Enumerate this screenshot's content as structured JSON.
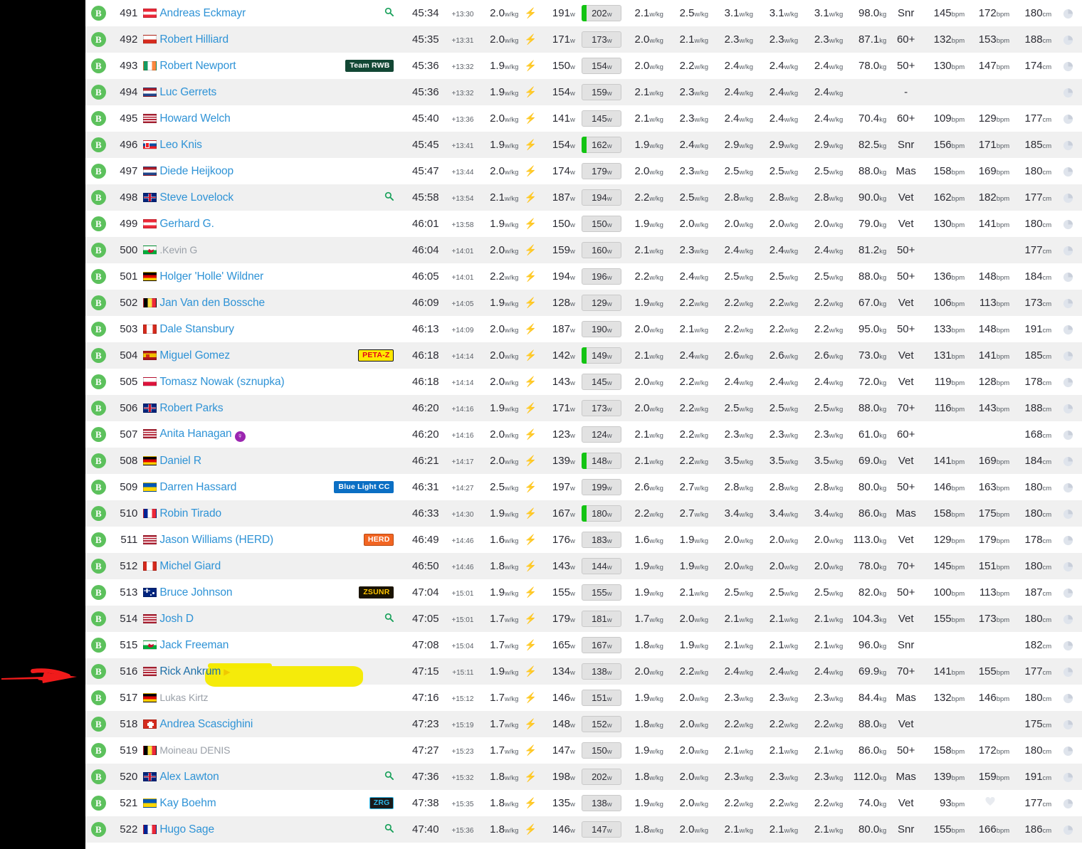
{
  "meta": {
    "highlighted_position": "516",
    "highlighted_rider": "Rick Ankrum",
    "annotation": {
      "type": "red-arrow",
      "points_to": "516"
    },
    "colors": {
      "rider_link": "#2f93d6",
      "badge_green": "#5cc15c",
      "bolt_green": "#28c840",
      "np_flag_green": "#13c413",
      "highlight_yellow": "#f5ea00",
      "arrow_red": "#f01b1b",
      "female_purple": "#9b26b0"
    }
  },
  "units": {
    "power": "w",
    "wkg": "w/kg",
    "weight": "kg",
    "hr": "bpm",
    "height": "cm"
  },
  "rows": [
    {
      "pos": "491",
      "flag": "at",
      "name": "Andreas Eckmayr",
      "muted": false,
      "search": true,
      "team": null,
      "time": "45:34",
      "gap": "+13:30",
      "wkg": "2.0",
      "bolt": true,
      "avg_power": "191",
      "np": "202",
      "np_flag": true,
      "p5": "2.1",
      "p4": "2.5",
      "p3": "3.1",
      "p2": "3.1",
      "p1": "3.1",
      "weight": "98.0",
      "cat": "Snr",
      "hr_avg": "145",
      "hr_max": "172",
      "height": "180",
      "hr_max_icon": false,
      "female": false,
      "play": false
    },
    {
      "pos": "492",
      "flag": "cl",
      "name": "Robert Hilliard",
      "muted": false,
      "search": false,
      "team": null,
      "time": "45:35",
      "gap": "+13:31",
      "wkg": "2.0",
      "bolt": true,
      "avg_power": "171",
      "np": "173",
      "np_flag": false,
      "p5": "2.0",
      "p4": "2.1",
      "p3": "2.3",
      "p2": "2.3",
      "p1": "2.3",
      "weight": "87.1",
      "cat": "60+",
      "hr_avg": "132",
      "hr_max": "153",
      "height": "188",
      "hr_max_icon": false,
      "female": false,
      "play": false
    },
    {
      "pos": "493",
      "flag": "ie",
      "name": "Robert Newport",
      "muted": false,
      "search": false,
      "team": {
        "label": "Team RWB",
        "bg": "#124734",
        "fg": "#ffffff",
        "border": "#124734"
      },
      "time": "45:36",
      "gap": "+13:32",
      "wkg": "1.9",
      "bolt": true,
      "avg_power": "150",
      "np": "154",
      "np_flag": false,
      "p5": "2.0",
      "p4": "2.2",
      "p3": "2.4",
      "p2": "2.4",
      "p1": "2.4",
      "weight": "78.0",
      "cat": "50+",
      "hr_avg": "130",
      "hr_max": "147",
      "height": "174",
      "hr_max_icon": false,
      "female": false,
      "play": false
    },
    {
      "pos": "494",
      "flag": "nl",
      "name": "Luc Gerrets",
      "muted": false,
      "search": false,
      "team": null,
      "time": "45:36",
      "gap": "+13:32",
      "wkg": "1.9",
      "bolt": true,
      "avg_power": "154",
      "np": "159",
      "np_flag": false,
      "p5": "2.1",
      "p4": "2.3",
      "p3": "2.4",
      "p2": "2.4",
      "p1": "2.4",
      "weight": "",
      "cat": "-",
      "hr_avg": "",
      "hr_max": "",
      "height": "",
      "hr_max_icon": false,
      "female": false,
      "play": false
    },
    {
      "pos": "495",
      "flag": "us",
      "name": "Howard Welch",
      "muted": false,
      "search": false,
      "team": null,
      "time": "45:40",
      "gap": "+13:36",
      "wkg": "2.0",
      "bolt": true,
      "avg_power": "141",
      "np": "145",
      "np_flag": false,
      "p5": "2.1",
      "p4": "2.3",
      "p3": "2.4",
      "p2": "2.4",
      "p1": "2.4",
      "weight": "70.4",
      "cat": "60+",
      "hr_avg": "109",
      "hr_max": "129",
      "height": "177",
      "hr_max_icon": false,
      "female": false,
      "play": false
    },
    {
      "pos": "496",
      "flag": "sk",
      "name": "Leo Knis",
      "muted": false,
      "search": false,
      "team": null,
      "time": "45:45",
      "gap": "+13:41",
      "wkg": "1.9",
      "bolt": true,
      "avg_power": "154",
      "np": "162",
      "np_flag": true,
      "p5": "1.9",
      "p4": "2.4",
      "p3": "2.9",
      "p2": "2.9",
      "p1": "2.9",
      "weight": "82.5",
      "cat": "Snr",
      "hr_avg": "156",
      "hr_max": "171",
      "height": "185",
      "hr_max_icon": false,
      "female": false,
      "play": false
    },
    {
      "pos": "497",
      "flag": "nl",
      "name": "Diede Heijkoop",
      "muted": false,
      "search": false,
      "team": null,
      "time": "45:47",
      "gap": "+13:44",
      "wkg": "2.0",
      "bolt": true,
      "avg_power": "174",
      "np": "179",
      "np_flag": false,
      "p5": "2.0",
      "p4": "2.3",
      "p3": "2.5",
      "p2": "2.5",
      "p1": "2.5",
      "weight": "88.0",
      "cat": "Mas",
      "hr_avg": "158",
      "hr_max": "169",
      "height": "180",
      "hr_max_icon": false,
      "female": false,
      "play": false
    },
    {
      "pos": "498",
      "flag": "gb",
      "name": "Steve Lovelock",
      "muted": false,
      "search": true,
      "team": null,
      "time": "45:58",
      "gap": "+13:54",
      "wkg": "2.1",
      "bolt": true,
      "avg_power": "187",
      "np": "194",
      "np_flag": false,
      "p5": "2.2",
      "p4": "2.5",
      "p3": "2.8",
      "p2": "2.8",
      "p1": "2.8",
      "weight": "90.0",
      "cat": "Vet",
      "hr_avg": "162",
      "hr_max": "182",
      "height": "177",
      "hr_max_icon": false,
      "female": false,
      "play": false
    },
    {
      "pos": "499",
      "flag": "at",
      "name": "Gerhard G.",
      "muted": false,
      "search": false,
      "team": null,
      "time": "46:01",
      "gap": "+13:58",
      "wkg": "1.9",
      "bolt": true,
      "avg_power": "150",
      "np": "150",
      "np_flag": false,
      "p5": "1.9",
      "p4": "2.0",
      "p3": "2.0",
      "p2": "2.0",
      "p1": "2.0",
      "weight": "79.0",
      "cat": "Vet",
      "hr_avg": "130",
      "hr_max": "141",
      "height": "180",
      "hr_max_icon": false,
      "female": false,
      "play": false
    },
    {
      "pos": "500",
      "flag": "wa",
      "name": ".Kevin G",
      "muted": true,
      "search": false,
      "team": null,
      "time": "46:04",
      "gap": "+14:01",
      "wkg": "2.0",
      "bolt": true,
      "avg_power": "159",
      "np": "160",
      "np_flag": false,
      "p5": "2.1",
      "p4": "2.3",
      "p3": "2.4",
      "p2": "2.4",
      "p1": "2.4",
      "weight": "81.2",
      "cat": "50+",
      "hr_avg": "",
      "hr_max": "",
      "height": "177",
      "hr_max_icon": false,
      "female": false,
      "play": false
    },
    {
      "pos": "501",
      "flag": "de",
      "name": "Holger 'Holle' Wildner",
      "muted": false,
      "search": false,
      "team": null,
      "time": "46:05",
      "gap": "+14:01",
      "wkg": "2.2",
      "bolt": true,
      "avg_power": "194",
      "np": "196",
      "np_flag": false,
      "p5": "2.2",
      "p4": "2.4",
      "p3": "2.5",
      "p2": "2.5",
      "p1": "2.5",
      "weight": "88.0",
      "cat": "50+",
      "hr_avg": "136",
      "hr_max": "148",
      "height": "184",
      "hr_max_icon": false,
      "female": false,
      "play": false
    },
    {
      "pos": "502",
      "flag": "be",
      "name": "Jan Van den Bossche",
      "muted": false,
      "search": false,
      "team": null,
      "time": "46:09",
      "gap": "+14:05",
      "wkg": "1.9",
      "bolt": true,
      "avg_power": "128",
      "np": "129",
      "np_flag": false,
      "p5": "1.9",
      "p4": "2.2",
      "p3": "2.2",
      "p2": "2.2",
      "p1": "2.2",
      "weight": "67.0",
      "cat": "Vet",
      "hr_avg": "106",
      "hr_max": "113",
      "height": "173",
      "hr_max_icon": false,
      "female": false,
      "play": false
    },
    {
      "pos": "503",
      "flag": "ca",
      "name": "Dale Stansbury",
      "muted": false,
      "search": false,
      "team": null,
      "time": "46:13",
      "gap": "+14:09",
      "wkg": "2.0",
      "bolt": true,
      "avg_power": "187",
      "np": "190",
      "np_flag": false,
      "p5": "2.0",
      "p4": "2.1",
      "p3": "2.2",
      "p2": "2.2",
      "p1": "2.2",
      "weight": "95.0",
      "cat": "50+",
      "hr_avg": "133",
      "hr_max": "148",
      "height": "191",
      "hr_max_icon": false,
      "female": false,
      "play": false
    },
    {
      "pos": "504",
      "flag": "es",
      "name": "Miguel Gomez",
      "muted": false,
      "search": false,
      "team": {
        "label": "PETA-Z",
        "bg": "#ffe800",
        "fg": "#e2001a",
        "border": "#111111"
      },
      "time": "46:18",
      "gap": "+14:14",
      "wkg": "2.0",
      "bolt": true,
      "avg_power": "142",
      "np": "149",
      "np_flag": true,
      "p5": "2.1",
      "p4": "2.4",
      "p3": "2.6",
      "p2": "2.6",
      "p1": "2.6",
      "weight": "73.0",
      "cat": "Vet",
      "hr_avg": "131",
      "hr_max": "141",
      "height": "185",
      "hr_max_icon": false,
      "female": false,
      "play": false
    },
    {
      "pos": "505",
      "flag": "pl",
      "name": "Tomasz Nowak (sznupka)",
      "muted": false,
      "search": false,
      "team": null,
      "time": "46:18",
      "gap": "+14:14",
      "wkg": "2.0",
      "bolt": true,
      "avg_power": "143",
      "np": "145",
      "np_flag": false,
      "p5": "2.0",
      "p4": "2.2",
      "p3": "2.4",
      "p2": "2.4",
      "p1": "2.4",
      "weight": "72.0",
      "cat": "Vet",
      "hr_avg": "119",
      "hr_max": "128",
      "height": "178",
      "hr_max_icon": false,
      "female": false,
      "play": false
    },
    {
      "pos": "506",
      "flag": "gb",
      "name": "Robert Parks",
      "muted": false,
      "search": false,
      "team": null,
      "time": "46:20",
      "gap": "+14:16",
      "wkg": "1.9",
      "bolt": true,
      "avg_power": "171",
      "np": "173",
      "np_flag": false,
      "p5": "2.0",
      "p4": "2.2",
      "p3": "2.5",
      "p2": "2.5",
      "p1": "2.5",
      "weight": "88.0",
      "cat": "70+",
      "hr_avg": "116",
      "hr_max": "143",
      "height": "188",
      "hr_max_icon": false,
      "female": false,
      "play": false
    },
    {
      "pos": "507",
      "flag": "us",
      "name": "Anita Hanagan",
      "muted": false,
      "search": false,
      "team": null,
      "time": "46:20",
      "gap": "+14:16",
      "wkg": "2.0",
      "bolt": true,
      "avg_power": "123",
      "np": "124",
      "np_flag": false,
      "p5": "2.1",
      "p4": "2.2",
      "p3": "2.3",
      "p2": "2.3",
      "p1": "2.3",
      "weight": "61.0",
      "cat": "60+",
      "hr_avg": "",
      "hr_max": "",
      "height": "168",
      "hr_max_icon": false,
      "female": true,
      "play": false
    },
    {
      "pos": "508",
      "flag": "de",
      "name": "Daniel R",
      "muted": false,
      "search": false,
      "team": null,
      "time": "46:21",
      "gap": "+14:17",
      "wkg": "2.0",
      "bolt": true,
      "avg_power": "139",
      "np": "148",
      "np_flag": true,
      "p5": "2.1",
      "p4": "2.2",
      "p3": "3.5",
      "p2": "3.5",
      "p1": "3.5",
      "weight": "69.0",
      "cat": "Vet",
      "hr_avg": "141",
      "hr_max": "169",
      "height": "184",
      "hr_max_icon": false,
      "female": false,
      "play": false
    },
    {
      "pos": "509",
      "flag": "ua",
      "name": "Darren Hassard",
      "muted": false,
      "search": false,
      "team": {
        "label": "Blue Light CC",
        "bg": "#0b6fc4",
        "fg": "#ffffff",
        "border": "#0b6fc4"
      },
      "time": "46:31",
      "gap": "+14:27",
      "wkg": "2.5",
      "bolt": true,
      "avg_power": "197",
      "np": "199",
      "np_flag": false,
      "p5": "2.6",
      "p4": "2.7",
      "p3": "2.8",
      "p2": "2.8",
      "p1": "2.8",
      "weight": "80.0",
      "cat": "50+",
      "hr_avg": "146",
      "hr_max": "163",
      "height": "180",
      "hr_max_icon": false,
      "female": false,
      "play": false
    },
    {
      "pos": "510",
      "flag": "fr",
      "name": "Robin Tirado",
      "muted": false,
      "search": false,
      "team": null,
      "time": "46:33",
      "gap": "+14:30",
      "wkg": "1.9",
      "bolt": true,
      "avg_power": "167",
      "np": "180",
      "np_flag": true,
      "p5": "2.2",
      "p4": "2.7",
      "p3": "3.4",
      "p2": "3.4",
      "p1": "3.4",
      "weight": "86.0",
      "cat": "Mas",
      "hr_avg": "158",
      "hr_max": "175",
      "height": "180",
      "hr_max_icon": false,
      "female": false,
      "play": false
    },
    {
      "pos": "511",
      "flag": "us",
      "name": "Jason Williams (HERD)",
      "muted": false,
      "search": false,
      "team": {
        "label": "HERD",
        "bg": "#f26522",
        "fg": "#ffffff",
        "border": "#b94a12"
      },
      "time": "46:49",
      "gap": "+14:46",
      "wkg": "1.6",
      "bolt": true,
      "avg_power": "176",
      "np": "183",
      "np_flag": false,
      "p5": "1.6",
      "p4": "1.9",
      "p3": "2.0",
      "p2": "2.0",
      "p1": "2.0",
      "weight": "113.0",
      "cat": "Vet",
      "hr_avg": "129",
      "hr_max": "179",
      "height": "178",
      "hr_max_icon": false,
      "female": false,
      "play": false
    },
    {
      "pos": "512",
      "flag": "ca",
      "name": "Michel Giard",
      "muted": false,
      "search": false,
      "team": null,
      "time": "46:50",
      "gap": "+14:46",
      "wkg": "1.8",
      "bolt": true,
      "avg_power": "143",
      "np": "144",
      "np_flag": false,
      "p5": "1.9",
      "p4": "1.9",
      "p3": "2.0",
      "p2": "2.0",
      "p1": "2.0",
      "weight": "78.0",
      "cat": "70+",
      "hr_avg": "145",
      "hr_max": "151",
      "height": "180",
      "hr_max_icon": false,
      "female": false,
      "play": false
    },
    {
      "pos": "513",
      "flag": "au",
      "name": "Bruce Johnson",
      "muted": false,
      "search": false,
      "team": {
        "label": "ZSUNR",
        "bg": "#1a1300",
        "fg": "#ffc400",
        "border": "#1a1300"
      },
      "time": "47:04",
      "gap": "+15:01",
      "wkg": "1.9",
      "bolt": true,
      "avg_power": "155",
      "np": "155",
      "np_flag": false,
      "p5": "1.9",
      "p4": "2.1",
      "p3": "2.5",
      "p2": "2.5",
      "p1": "2.5",
      "weight": "82.0",
      "cat": "50+",
      "hr_avg": "100",
      "hr_max": "113",
      "height": "187",
      "hr_max_icon": false,
      "female": false,
      "play": false
    },
    {
      "pos": "514",
      "flag": "us",
      "name": "Josh D",
      "muted": false,
      "search": true,
      "team": null,
      "time": "47:05",
      "gap": "+15:01",
      "wkg": "1.7",
      "bolt": true,
      "avg_power": "179",
      "np": "181",
      "np_flag": false,
      "p5": "1.7",
      "p4": "2.0",
      "p3": "2.1",
      "p2": "2.1",
      "p1": "2.1",
      "weight": "104.3",
      "cat": "Vet",
      "hr_avg": "155",
      "hr_max": "173",
      "height": "180",
      "hr_max_icon": false,
      "female": false,
      "play": false
    },
    {
      "pos": "515",
      "flag": "wa",
      "name": "Jack Freeman",
      "muted": false,
      "search": false,
      "team": null,
      "time": "47:08",
      "gap": "+15:04",
      "wkg": "1.7",
      "bolt": true,
      "avg_power": "165",
      "np": "167",
      "np_flag": false,
      "p5": "1.8",
      "p4": "1.9",
      "p3": "2.1",
      "p2": "2.1",
      "p1": "2.1",
      "weight": "96.0",
      "cat": "Snr",
      "hr_avg": "",
      "hr_max": "",
      "height": "182",
      "hr_max_icon": false,
      "female": false,
      "play": false
    },
    {
      "pos": "516",
      "flag": "us",
      "name": "Rick Ankrum",
      "muted": false,
      "search": false,
      "team": null,
      "time": "47:15",
      "gap": "+15:11",
      "wkg": "1.9",
      "bolt": true,
      "avg_power": "134",
      "np": "138",
      "np_flag": false,
      "p5": "2.0",
      "p4": "2.2",
      "p3": "2.4",
      "p2": "2.4",
      "p1": "2.4",
      "weight": "69.9",
      "cat": "70+",
      "hr_avg": "141",
      "hr_max": "155",
      "height": "177",
      "hr_max_icon": false,
      "female": false,
      "play": true
    },
    {
      "pos": "517",
      "flag": "de",
      "name": "Lukas Kirtz",
      "muted": true,
      "search": false,
      "team": null,
      "time": "47:16",
      "gap": "+15:12",
      "wkg": "1.7",
      "bolt": true,
      "avg_power": "146",
      "np": "151",
      "np_flag": false,
      "p5": "1.9",
      "p4": "2.0",
      "p3": "2.3",
      "p2": "2.3",
      "p1": "2.3",
      "weight": "84.4",
      "cat": "Mas",
      "hr_avg": "132",
      "hr_max": "146",
      "height": "180",
      "hr_max_icon": false,
      "female": false,
      "play": false
    },
    {
      "pos": "518",
      "flag": "ch",
      "name": "Andrea Scascighini",
      "muted": false,
      "search": false,
      "team": null,
      "time": "47:23",
      "gap": "+15:19",
      "wkg": "1.7",
      "bolt": true,
      "avg_power": "148",
      "np": "152",
      "np_flag": false,
      "p5": "1.8",
      "p4": "2.0",
      "p3": "2.2",
      "p2": "2.2",
      "p1": "2.2",
      "weight": "88.0",
      "cat": "Vet",
      "hr_avg": "",
      "hr_max": "",
      "height": "175",
      "hr_max_icon": false,
      "female": false,
      "play": false
    },
    {
      "pos": "519",
      "flag": "be",
      "name": "Moineau DENIS",
      "muted": true,
      "search": false,
      "team": null,
      "time": "47:27",
      "gap": "+15:23",
      "wkg": "1.7",
      "bolt": true,
      "avg_power": "147",
      "np": "150",
      "np_flag": false,
      "p5": "1.9",
      "p4": "2.0",
      "p3": "2.1",
      "p2": "2.1",
      "p1": "2.1",
      "weight": "86.0",
      "cat": "50+",
      "hr_avg": "158",
      "hr_max": "172",
      "height": "180",
      "hr_max_icon": false,
      "female": false,
      "play": false
    },
    {
      "pos": "520",
      "flag": "gb",
      "name": "Alex Lawton",
      "muted": false,
      "search": true,
      "team": null,
      "time": "47:36",
      "gap": "+15:32",
      "wkg": "1.8",
      "bolt": true,
      "avg_power": "198",
      "np": "202",
      "np_flag": false,
      "p5": "1.8",
      "p4": "2.0",
      "p3": "2.3",
      "p2": "2.3",
      "p1": "2.3",
      "weight": "112.0",
      "cat": "Mas",
      "hr_avg": "139",
      "hr_max": "159",
      "height": "191",
      "hr_max_icon": false,
      "female": false,
      "play": false
    },
    {
      "pos": "521",
      "flag": "ua",
      "name": "Kay Boehm",
      "muted": false,
      "search": false,
      "team": {
        "label": "ZRG",
        "bg": "#1a1a1a",
        "fg": "#2fb8e8",
        "border": "#2fb8e8"
      },
      "time": "47:38",
      "gap": "+15:35",
      "wkg": "1.8",
      "bolt": true,
      "avg_power": "135",
      "np": "138",
      "np_flag": false,
      "p5": "1.9",
      "p4": "2.0",
      "p3": "2.2",
      "p2": "2.2",
      "p1": "2.2",
      "weight": "74.0",
      "cat": "Vet",
      "hr_avg": "93",
      "hr_max": "",
      "height": "177",
      "hr_max_icon": true,
      "female": false,
      "play": false
    },
    {
      "pos": "522",
      "flag": "fr",
      "name": "Hugo Sage",
      "muted": false,
      "search": true,
      "team": null,
      "time": "47:40",
      "gap": "+15:36",
      "wkg": "1.8",
      "bolt": true,
      "avg_power": "146",
      "np": "147",
      "np_flag": false,
      "p5": "1.8",
      "p4": "2.0",
      "p3": "2.1",
      "p2": "2.1",
      "p1": "2.1",
      "weight": "80.0",
      "cat": "Snr",
      "hr_avg": "155",
      "hr_max": "166",
      "height": "186",
      "hr_max_icon": false,
      "female": false,
      "play": false
    }
  ]
}
